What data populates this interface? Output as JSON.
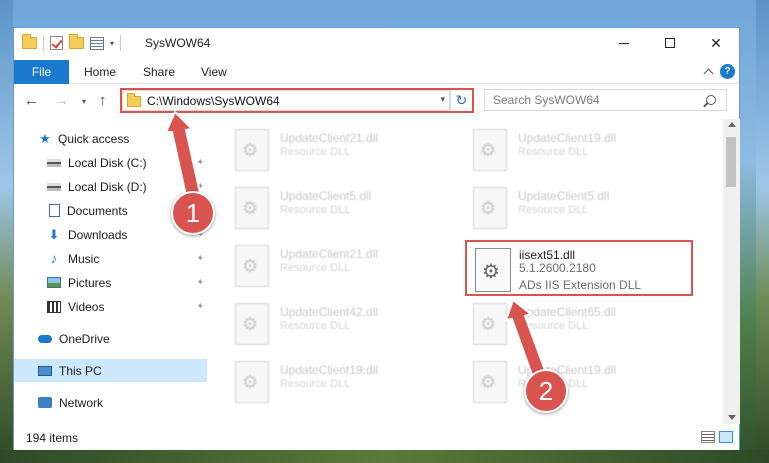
{
  "window": {
    "title": "SysWOW64",
    "controls": {
      "minimize": "—",
      "maximize": "□",
      "close": "✕"
    }
  },
  "ribbon": {
    "file": "File",
    "tabs": [
      "Home",
      "Share",
      "View"
    ],
    "help": "?"
  },
  "nav": {
    "back": "←",
    "forward": "→",
    "recent": "▾",
    "up": "↑",
    "address": "C:\\Windows\\SysWOW64",
    "address_dropdown": "▾",
    "refresh": "↻",
    "search_placeholder": "Search SysWOW64"
  },
  "sidebar": {
    "items": [
      {
        "label": "Quick access",
        "icon": "star-icon",
        "glyph": "★"
      },
      {
        "label": "Local Disk (C:)",
        "icon": "drive-icon",
        "pinned": true
      },
      {
        "label": "Local Disk (D:)",
        "icon": "drive-icon",
        "pinned": true
      },
      {
        "label": "Documents",
        "icon": "document-icon",
        "pinned": true
      },
      {
        "label": "Downloads",
        "icon": "download-icon",
        "glyph": "⬇",
        "pinned": true
      },
      {
        "label": "Music",
        "icon": "music-icon",
        "glyph": "♪",
        "pinned": true
      },
      {
        "label": "Pictures",
        "icon": "picture-icon",
        "pinned": true
      },
      {
        "label": "Videos",
        "icon": "video-icon",
        "pinned": true
      },
      {
        "label": "OneDrive",
        "icon": "cloud-icon"
      },
      {
        "label": "This PC",
        "icon": "computer-icon",
        "selected": true
      },
      {
        "label": "Network",
        "icon": "network-icon"
      }
    ],
    "pin_glyph": "📌"
  },
  "files": {
    "left_column": [
      {
        "name": "UpdateClient21.dll",
        "desc": "Resource DLL"
      },
      {
        "name": "UpdateClient5.dll",
        "desc": "Resource DLL"
      },
      {
        "name": "UpdateClient21.dll",
        "desc": "Resource DLL"
      },
      {
        "name": "UpdateClient42.dll",
        "desc": "Resource DLL"
      },
      {
        "name": "UpdateClient19.dll",
        "desc": "Resource DLL"
      }
    ],
    "right_column": [
      {
        "name": "UpdateClient19.dll",
        "desc": "Resource DLL"
      },
      {
        "name": "UpdateClient5.dll",
        "desc": "Resource DLL"
      },
      {
        "name": "UpdateClient65.dll",
        "desc": "Resource DLL"
      },
      {
        "name": "UpdateClient19.dll",
        "desc": "Resource DLL"
      }
    ],
    "highlighted": {
      "name": "iisext51.dll",
      "version": "5.1.2600.2180",
      "desc": "ADs IIS Extension DLL"
    }
  },
  "status": {
    "item_count": "194 items"
  },
  "annotations": {
    "step1": "1",
    "step2": "2",
    "color": "#d9534f"
  }
}
